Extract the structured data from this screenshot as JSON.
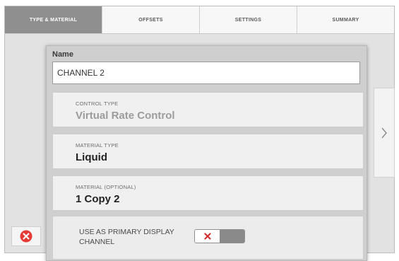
{
  "tabs": [
    {
      "label": "TYPE & MATERIAL",
      "active": true
    },
    {
      "label": "OFFSETS",
      "active": false
    },
    {
      "label": "SETTINGS",
      "active": false
    },
    {
      "label": "SUMMARY",
      "active": false
    }
  ],
  "form": {
    "name_label": "Name",
    "name_value": "CHANNEL 2",
    "control_type": {
      "caption": "CONTROL TYPE",
      "value": "Virtual Rate Control"
    },
    "material_type": {
      "caption": "MATERIAL TYPE",
      "value": "Liquid"
    },
    "material": {
      "caption": "MATERIAL (OPTIONAL)",
      "value": "1 Copy 2"
    },
    "primary_display": {
      "label": "USE AS PRIMARY DISPLAY CHANNEL",
      "enabled": false
    }
  },
  "icons": {
    "next": "chevron-right-icon",
    "close": "close-circle-icon",
    "toggle_off": "x-icon"
  },
  "colors": {
    "active_tab": "#8f8f8f",
    "close_red": "#e53935",
    "toggle_x_red": "#d32f2f"
  }
}
